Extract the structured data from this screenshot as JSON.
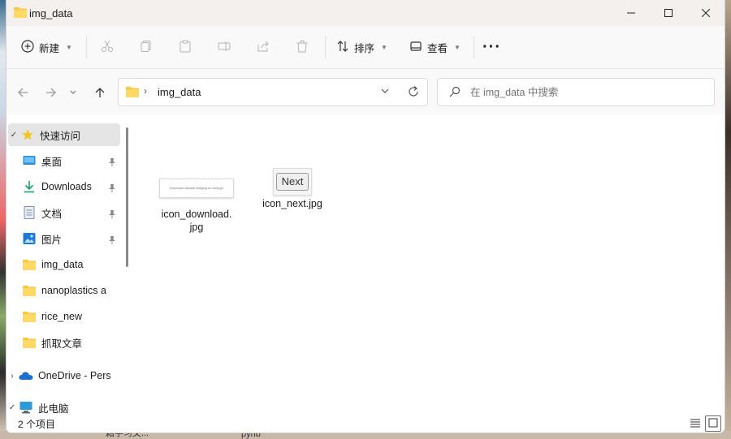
{
  "window": {
    "title": "img_data"
  },
  "toolbar": {
    "new_label": "新建",
    "sort_label": "排序",
    "view_label": "查看",
    "more_label": "···"
  },
  "address": {
    "path": "img_data"
  },
  "search": {
    "placeholder": "在 img_data 中搜索"
  },
  "sidebar": {
    "items": [
      {
        "label": "快速访问",
        "icon": "star-icon"
      },
      {
        "label": "桌面",
        "icon": "desktop-icon"
      },
      {
        "label": "Downloads",
        "icon": "download-icon"
      },
      {
        "label": "文档",
        "icon": "document-icon"
      },
      {
        "label": "图片",
        "icon": "pictures-icon"
      },
      {
        "label": "img_data",
        "icon": "folder-icon"
      },
      {
        "label": "nanoplastics a",
        "icon": "folder-icon"
      },
      {
        "label": "rice_new",
        "icon": "folder-icon"
      },
      {
        "label": "抓取文章",
        "icon": "folder-icon"
      },
      {
        "label": "OneDrive - Pers",
        "icon": "onedrive-icon"
      },
      {
        "label": "此电脑",
        "icon": "computer-icon"
      }
    ]
  },
  "files": [
    {
      "name": "icon_download.jpg",
      "name_line1": "icon_download.",
      "name_line2": "jpg",
      "thumb_text": "Download always imaging on body.jcr"
    },
    {
      "name": "icon_next.jpg",
      "thumb_text": "Next"
    }
  ],
  "status": {
    "count": "2 个项目"
  },
  "desktop": {
    "bottom_left": "籍学习文...",
    "bottom_mid": "pynb"
  },
  "colors": {
    "folder": "#F8C843",
    "accent": "#0067C0",
    "selected": "#E5E5E5"
  }
}
